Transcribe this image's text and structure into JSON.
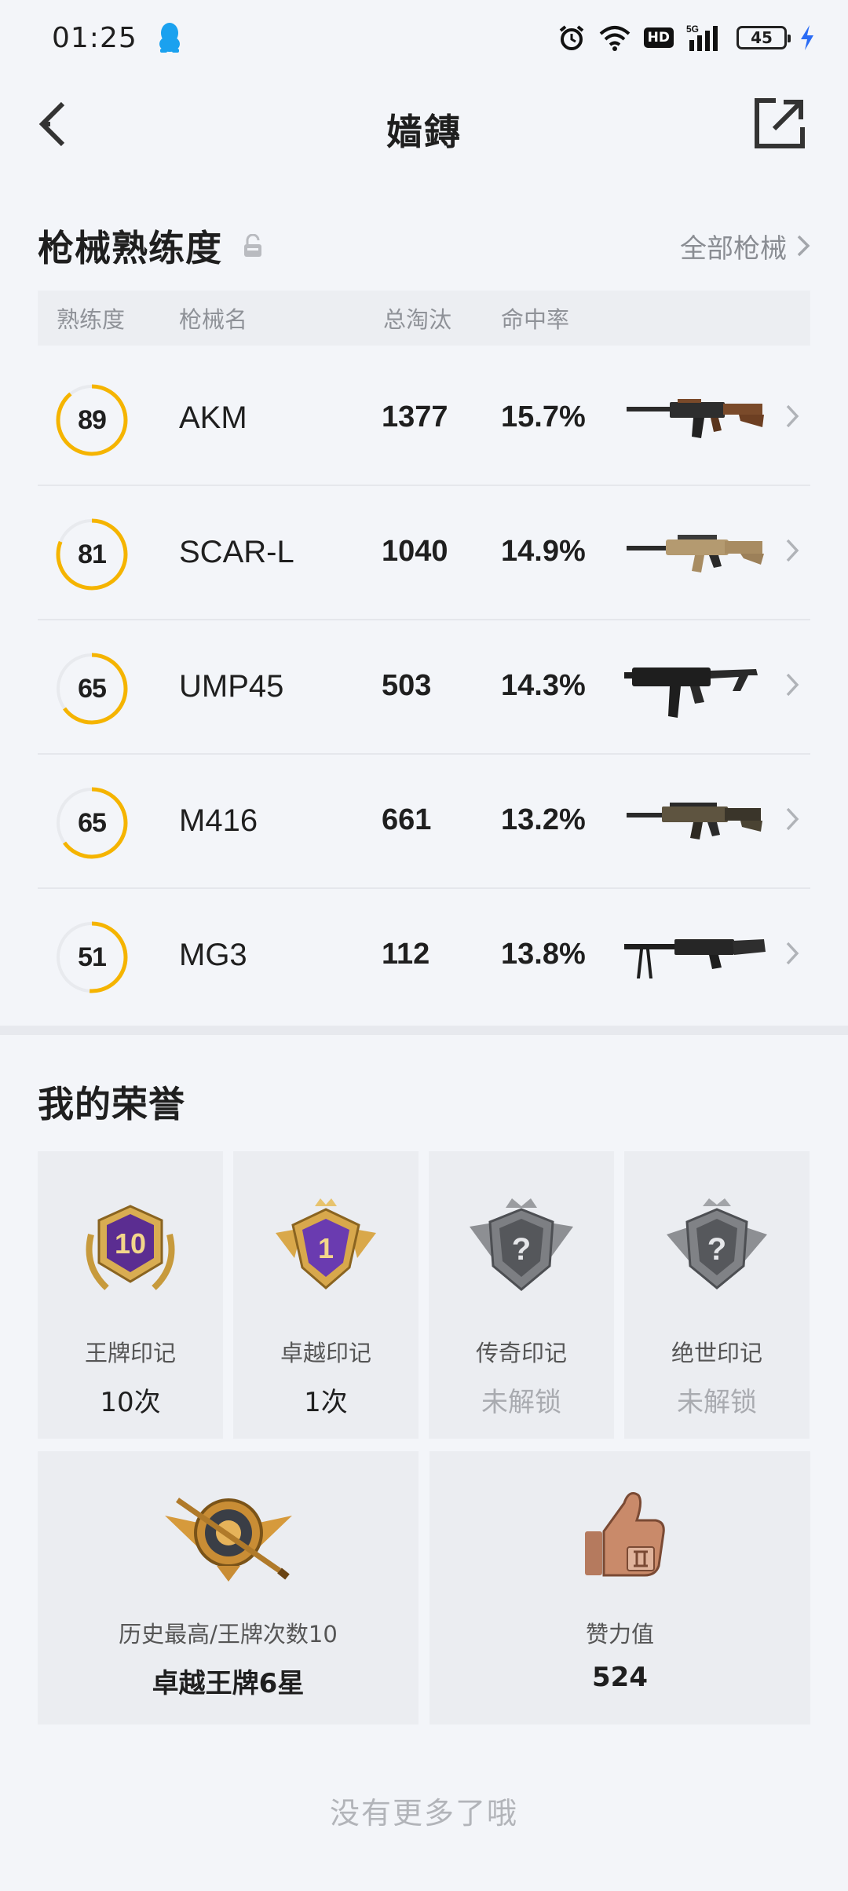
{
  "status_bar": {
    "time": "01:25",
    "battery": "45",
    "network": "5G",
    "hd": "HD"
  },
  "header": {
    "title": "嫱鏄"
  },
  "weapons_section": {
    "title": "枪械熟练度",
    "all_link": "全部枪械",
    "columns": [
      "熟练度",
      "枪械名",
      "总淘汰",
      "命中率"
    ],
    "rows": [
      {
        "mastery": "89",
        "mastery_level": 89,
        "name": "AKM",
        "kills": "1377",
        "hit_rate": "15.7%",
        "image_icon": "akm-rifle-icon"
      },
      {
        "mastery": "81",
        "mastery_level": 81,
        "name": "SCAR-L",
        "kills": "1040",
        "hit_rate": "14.9%",
        "image_icon": "scar-rifle-icon"
      },
      {
        "mastery": "65",
        "mastery_level": 65,
        "name": "UMP45",
        "kills": "503",
        "hit_rate": "14.3%",
        "image_icon": "ump-smg-icon"
      },
      {
        "mastery": "65",
        "mastery_level": 65,
        "name": "M416",
        "kills": "661",
        "hit_rate": "13.2%",
        "image_icon": "m416-rifle-icon"
      },
      {
        "mastery": "51",
        "mastery_level": 51,
        "name": "MG3",
        "kills": "112",
        "hit_rate": "13.8%",
        "image_icon": "mg3-lmg-icon"
      }
    ]
  },
  "honors_section": {
    "title": "我的荣誉",
    "cards": [
      {
        "label": "王牌印记",
        "value": "10次",
        "locked": false,
        "emblem_text": "10",
        "emblem_icon": "ace-mark-emblem-icon"
      },
      {
        "label": "卓越印记",
        "value": "1次",
        "locked": false,
        "emblem_text": "1",
        "emblem_icon": "excellence-mark-emblem-icon"
      },
      {
        "label": "传奇印记",
        "value": "未解锁",
        "locked": true,
        "emblem_text": "?",
        "emblem_icon": "legend-mark-emblem-icon"
      },
      {
        "label": "绝世印记",
        "value": "未解锁",
        "locked": true,
        "emblem_text": "?",
        "emblem_icon": "peerless-mark-emblem-icon"
      }
    ],
    "bottom_cards": [
      {
        "label": "历史最高/王牌次数10",
        "value": "卓越王牌6星",
        "emblem_icon": "rank-badge-icon"
      },
      {
        "label": "赞力值",
        "value": "524",
        "emblem_icon": "thumbs-up-icon"
      }
    ]
  },
  "footer": {
    "no_more": "没有更多了哦"
  },
  "colors": {
    "accent": "#f5b400",
    "ring_track": "#e8eaee",
    "background": "#f3f5f9"
  }
}
